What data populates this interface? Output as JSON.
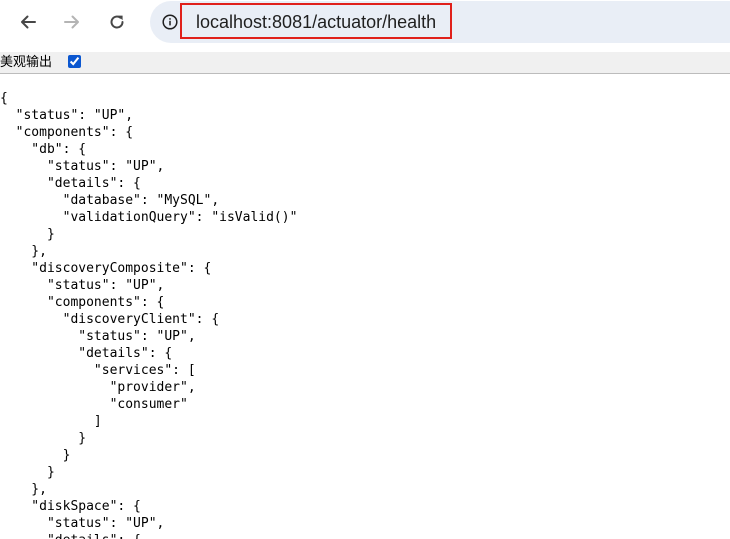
{
  "browser": {
    "url": "localhost:8081/actuator/health",
    "back_icon": "arrow-left-icon",
    "forward_icon": "arrow-right-icon",
    "reload_icon": "reload-icon",
    "info_icon": "info-circle-icon",
    "highlight_color": "#e0201b"
  },
  "pretty_print": {
    "label": "美观输出",
    "checked": true
  },
  "json_lines": [
    "{",
    "  \"status\": \"UP\",",
    "  \"components\": {",
    "    \"db\": {",
    "      \"status\": \"UP\",",
    "      \"details\": {",
    "        \"database\": \"MySQL\",",
    "        \"validationQuery\": \"isValid()\"",
    "      }",
    "    },",
    "    \"discoveryComposite\": {",
    "      \"status\": \"UP\",",
    "      \"components\": {",
    "        \"discoveryClient\": {",
    "          \"status\": \"UP\",",
    "          \"details\": {",
    "            \"services\": [",
    "              \"provider\",",
    "              \"consumer\"",
    "            ]",
    "          }",
    "        }",
    "      }",
    "    },",
    "    \"diskSpace\": {",
    "      \"status\": \"UP\",",
    "      \"details\": {"
  ]
}
